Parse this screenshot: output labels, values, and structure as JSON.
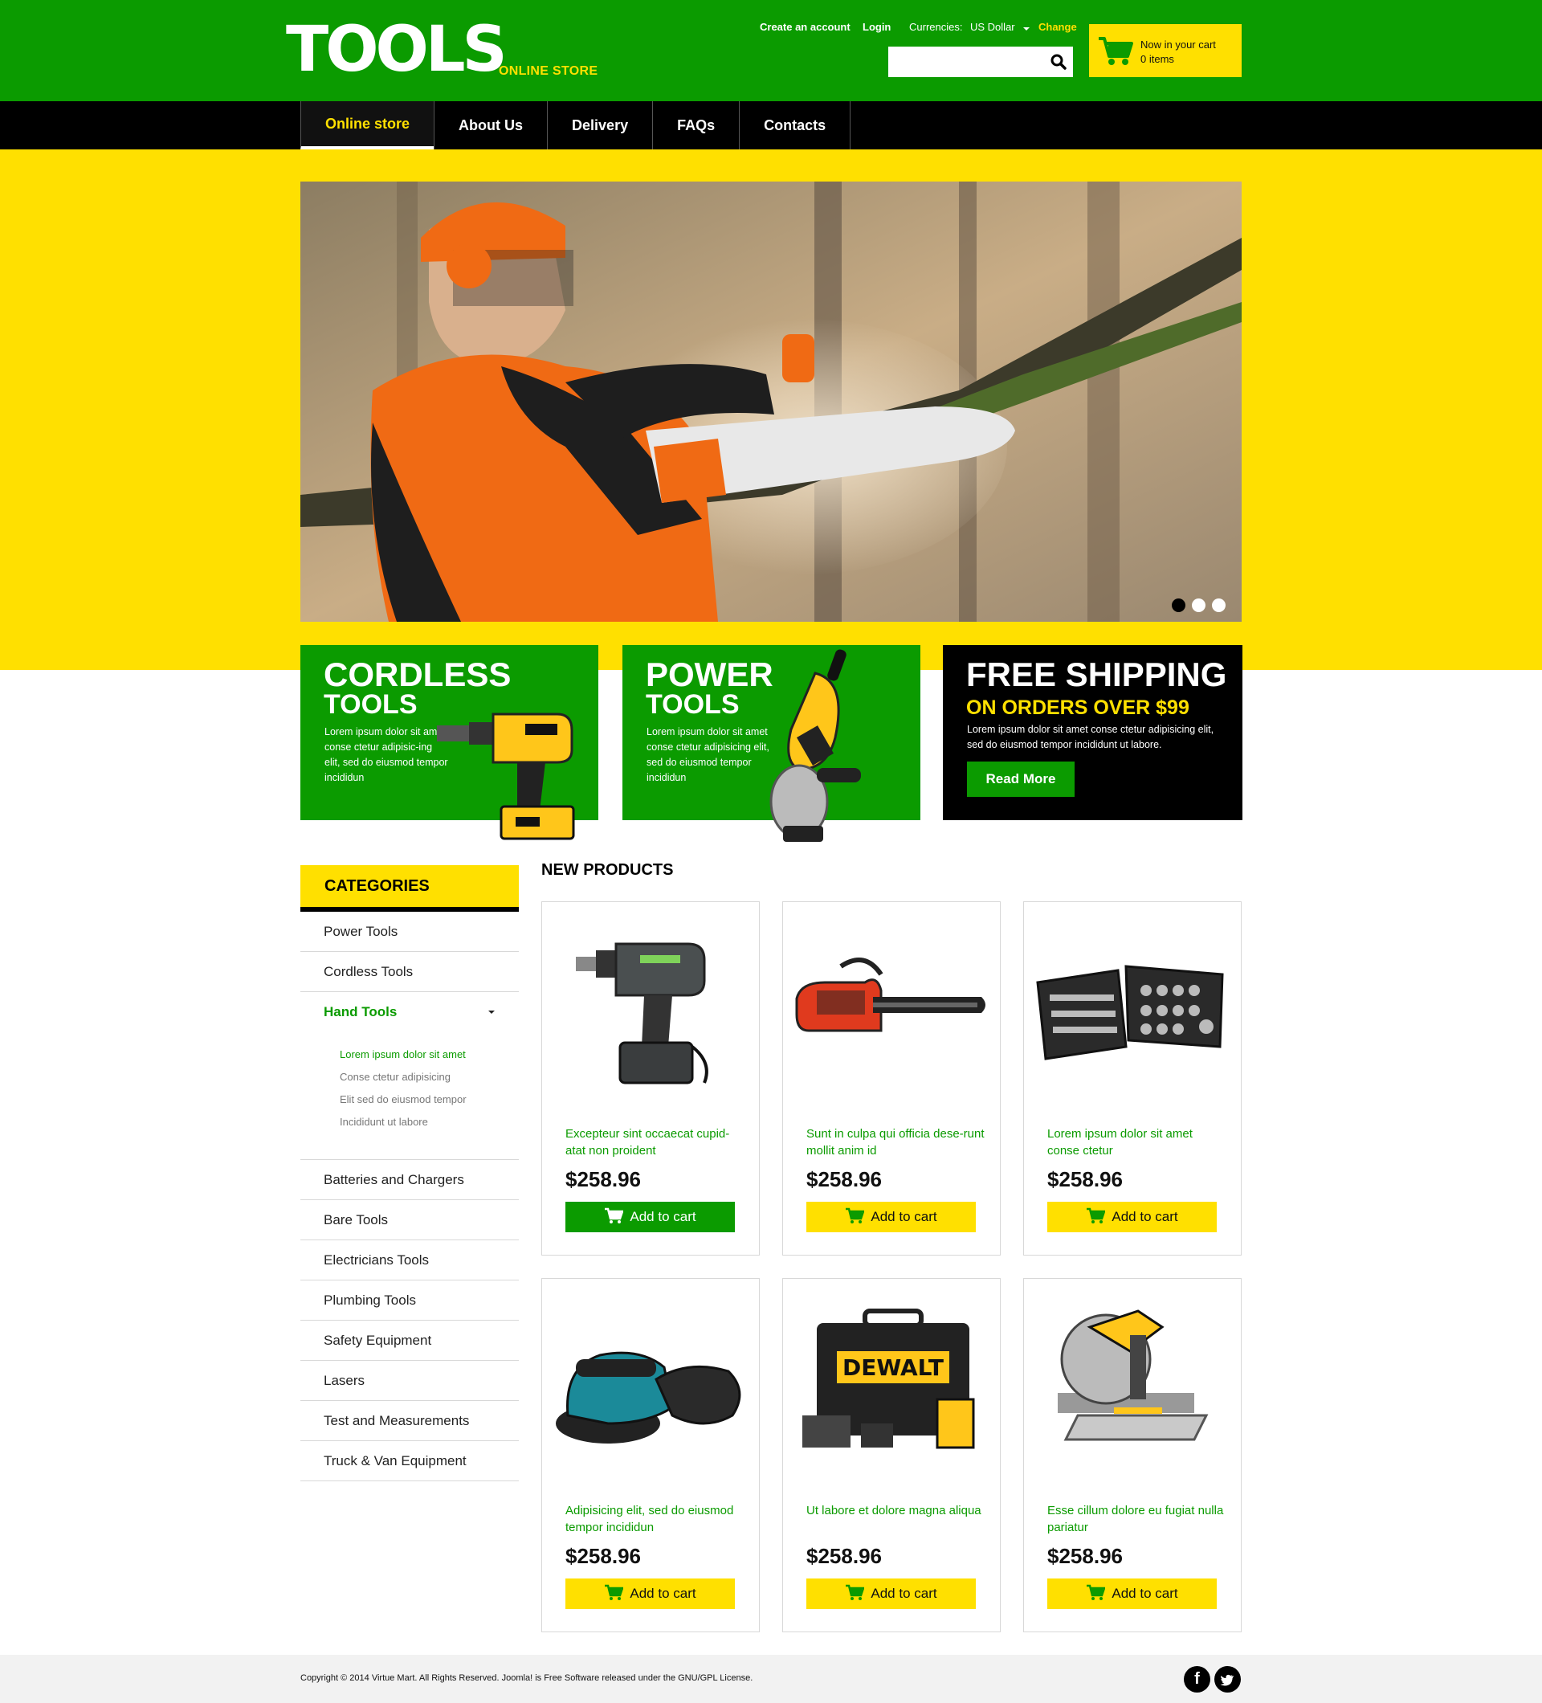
{
  "brand": {
    "logo_main": "TOOLS",
    "logo_sub": "ONLINE STORE"
  },
  "header": {
    "create_account": "Create an account",
    "login": "Login",
    "currencies_label": "Currencies:",
    "currency_value": "US Dollar",
    "change": "Change",
    "search_placeholder": "",
    "cart_line1": "Now in your cart",
    "cart_line2": "0 items"
  },
  "nav": {
    "items": [
      {
        "label": "Online store",
        "active": true
      },
      {
        "label": "About Us"
      },
      {
        "label": "Delivery"
      },
      {
        "label": "FAQs"
      },
      {
        "label": "Contacts"
      }
    ]
  },
  "slider": {
    "slides": 3,
    "active_slide": 1
  },
  "promos": {
    "cordless": {
      "title": "CORDLESS",
      "title2": "TOOLS",
      "text": "Lorem ipsum dolor sit amet conse ctetur adipisic-ing elit, sed do eiusmod tempor incididun"
    },
    "power": {
      "title": "POWER",
      "title2": "TOOLS",
      "text": "Lorem ipsum dolor sit amet conse ctetur adipisicing elit, sed do eiusmod tempor incididun"
    },
    "shipping": {
      "title": "FREE SHIPPING",
      "subtitle": "ON ORDERS OVER $99",
      "text": "Lorem ipsum dolor sit amet conse ctetur adipisicing elit, sed do eiusmod tempor incididunt ut labore.",
      "button": "Read More"
    }
  },
  "sidebar": {
    "title": "CATEGORIES",
    "items": [
      "Power Tools",
      "Cordless Tools",
      "Hand Tools",
      "Batteries and Chargers",
      "Bare Tools",
      "Electricians Tools",
      "Plumbing Tools",
      "Safety Equipment",
      "Lasers",
      "Test and Measurements",
      "Truck & Van Equipment"
    ],
    "subitems": [
      "Lorem ipsum dolor sit amet",
      "Conse ctetur adipisicing",
      "Elit sed do eiusmod tempor",
      "Incididunt ut labore"
    ]
  },
  "products": {
    "title": "NEW PRODUCTS",
    "button_label": "Add to cart",
    "items": [
      {
        "name": "Excepteur sint occaecat cupid-atat non proident",
        "price": "$258.96",
        "icon": "drill-icon"
      },
      {
        "name": "Sunt in culpa qui officia dese-runt mollit anim id",
        "price": "$258.96",
        "icon": "chainsaw-icon"
      },
      {
        "name": "Lorem ipsum dolor sit amet conse ctetur",
        "price": "$258.96",
        "icon": "socket-set-icon"
      },
      {
        "name": "Adipisicing elit, sed do eiusmod tempor incididun",
        "price": "$258.96",
        "icon": "sander-icon"
      },
      {
        "name": "Ut labore et dolore magna aliqua",
        "price": "$258.96",
        "icon": "drill-case-icon"
      },
      {
        "name": "Esse cillum dolore eu fugiat nulla pariatur",
        "price": "$258.96",
        "icon": "miter-saw-icon"
      }
    ],
    "case_label": "DEWALT"
  },
  "footer": {
    "copyright": "Copyright © 2014 Virtue Mart.  All Rights Reserved. Joomla! is Free Software released under the GNU/GPL License.",
    "facebook": "f",
    "twitter_icon": "twitter-icon"
  },
  "colors": {
    "green": "#0b9b00",
    "yellow": "#ffe000",
    "black": "#000000"
  }
}
